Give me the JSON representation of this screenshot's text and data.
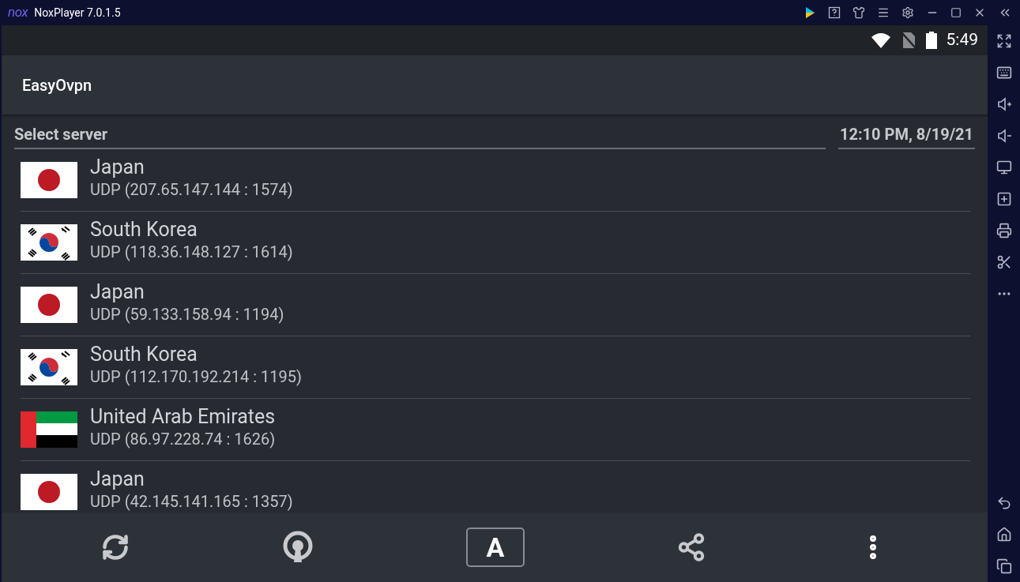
{
  "window": {
    "logo": "nox",
    "title": "NoxPlayer 7.0.1.5"
  },
  "status_bar": {
    "time": "5:49"
  },
  "app_bar": {
    "title": "EasyOvpn"
  },
  "list_header": {
    "label": "Select server",
    "timestamp": "12:10 PM, 8/19/21"
  },
  "servers": [
    {
      "country": "Japan",
      "kind": "japan",
      "address": "UDP (207.65.147.144 : 1574)"
    },
    {
      "country": "South Korea",
      "kind": "south_korea",
      "address": "UDP (118.36.148.127 : 1614)"
    },
    {
      "country": "Japan",
      "kind": "japan",
      "address": "UDP (59.133.158.94 : 1194)"
    },
    {
      "country": "South Korea",
      "kind": "south_korea",
      "address": "UDP (112.170.192.214 : 1195)"
    },
    {
      "country": "United Arab Emirates",
      "kind": "uae",
      "address": "UDP (86.97.228.74 : 1626)"
    },
    {
      "country": "Japan",
      "kind": "japan",
      "address": "UDP (42.145.141.165 : 1357)"
    }
  ],
  "bottom_bar": {
    "sort_label": "A"
  }
}
